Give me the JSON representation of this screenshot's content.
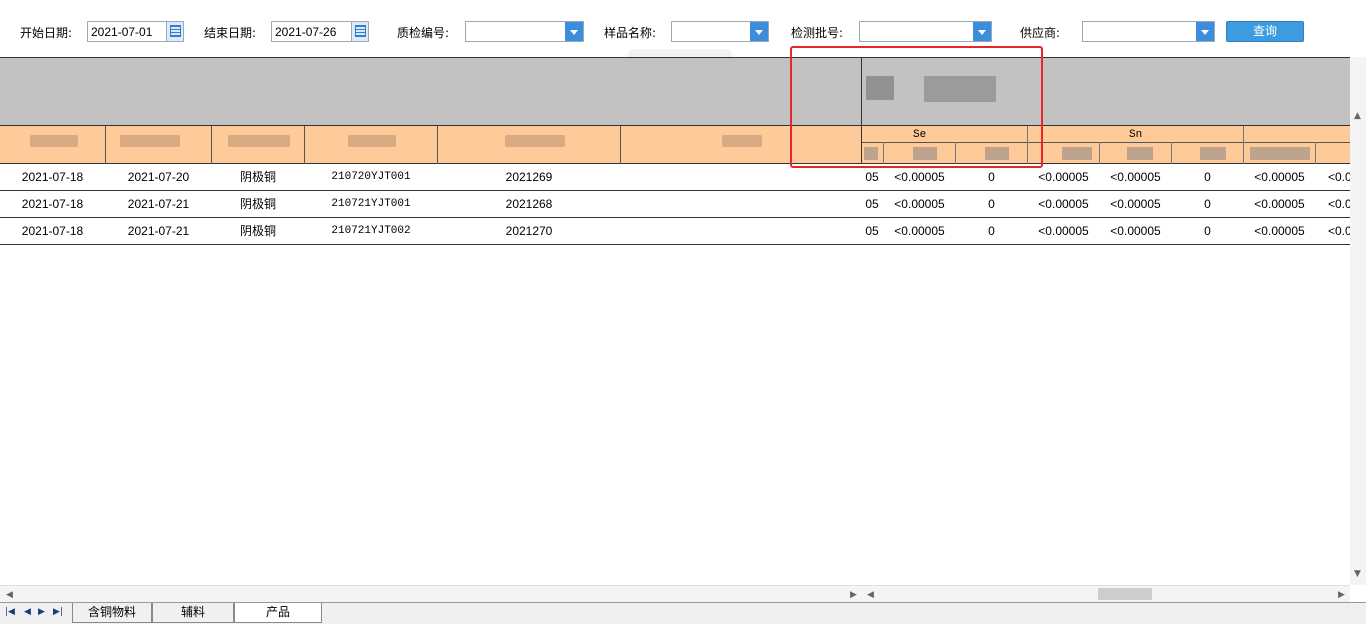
{
  "filters": {
    "start_date_label": "开始日期:",
    "start_date_value": "2021-07-01",
    "end_date_label": "结束日期:",
    "end_date_value": "2021-07-26",
    "qc_no_label": "质检编号:",
    "sample_name_label": "样品名称:",
    "batch_no_label": "检测批号:",
    "supplier_label": "供应商:",
    "query_button": "查询"
  },
  "table": {
    "element_headers": [
      "Se",
      "Sn"
    ],
    "rows": [
      {
        "c1": "2021-07-18",
        "c2": "2021-07-20",
        "c3": "阴极铜",
        "c4": "210720YJT001",
        "c5": "2021269",
        "c6": "",
        "v0": "05",
        "v1": "<0.00005",
        "v2": "0",
        "v3": "<0.00005",
        "v4": "<0.00005",
        "v5": "0",
        "v6": "<0.00005",
        "v7": "<0.0"
      },
      {
        "c1": "2021-07-18",
        "c2": "2021-07-21",
        "c3": "阴极铜",
        "c4": "210721YJT001",
        "c5": "2021268",
        "c6": "",
        "v0": "05",
        "v1": "<0.00005",
        "v2": "0",
        "v3": "<0.00005",
        "v4": "<0.00005",
        "v5": "0",
        "v6": "<0.00005",
        "v7": "<0.0"
      },
      {
        "c1": "2021-07-18",
        "c2": "2021-07-21",
        "c3": "阴极铜",
        "c4": "210721YJT002",
        "c5": "2021270",
        "c6": "",
        "v0": "05",
        "v1": "<0.00005",
        "v2": "0",
        "v3": "<0.00005",
        "v4": "<0.00005",
        "v5": "0",
        "v6": "<0.00005",
        "v7": "<0.0"
      }
    ]
  },
  "sheet_tabs": [
    "含铜物料",
    "辅料",
    "产品"
  ],
  "colors": {
    "header_gray": "#c2c2c2",
    "header_orange": "#ffca9a",
    "accent_blue": "#3f9be0",
    "highlight_red": "#e8262a"
  }
}
